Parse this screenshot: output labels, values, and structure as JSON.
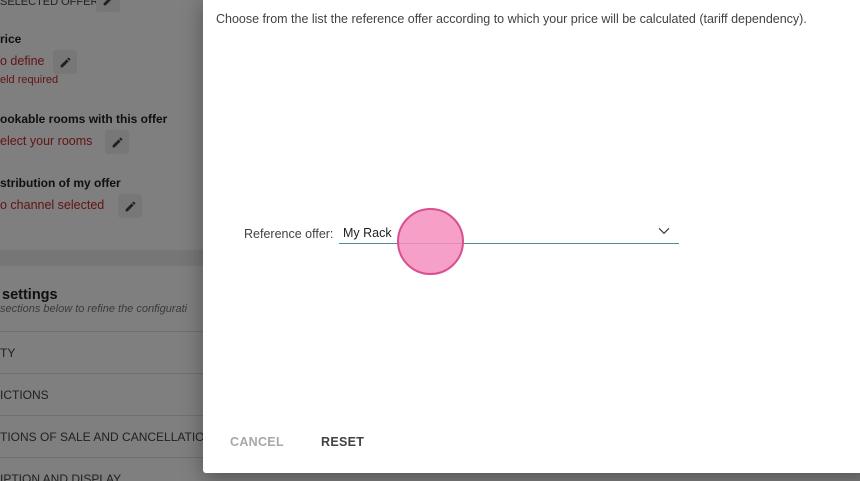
{
  "background": {
    "top_field_label": "SELECTED OFFER",
    "price": {
      "label": "rice",
      "value": "o define",
      "error": "eld required"
    },
    "rooms": {
      "label": "ookable rooms with this offer",
      "value": "elect your rooms"
    },
    "distribution": {
      "label": "stribution of my offer",
      "value": "o channel selected"
    },
    "settings": {
      "title": "settings",
      "subtitle": "sections below to refine the configurati",
      "rows": [
        "TY",
        "ICTIONS",
        "TIONS OF SALE AND CANCELLATIO",
        "IPTION AND DISPLAY"
      ]
    }
  },
  "dialog": {
    "description": "Choose from the list the reference offer according to which your price will be calculated (tariff dependency).",
    "reference_label": "Reference offer:",
    "reference_value": "My Rack",
    "cancel_label": "CANCEL",
    "reset_label": "RESET"
  },
  "colors": {
    "error_red": "#c62828",
    "select_underline": "#4a8f98",
    "click_indicator": "#f48fbe"
  },
  "icons": [
    "pencil-icon",
    "chevron-down-icon"
  ]
}
